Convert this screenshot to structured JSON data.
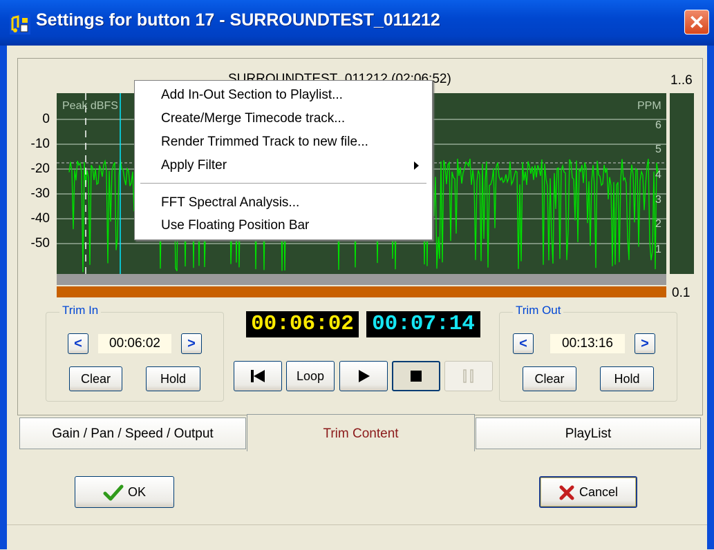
{
  "window": {
    "title": "Settings for button 17 - SURROUNDTEST_011212",
    "close_glyph": "✕"
  },
  "waveform": {
    "title": "SURROUNDTEST_011212   (02:06:52)",
    "scale_top": "1..6",
    "scale_bottom": "0.1",
    "peak_label": "Peak dBFS",
    "ppm_label": "PPM",
    "y_labels": [
      "0",
      "-10",
      "-20",
      "-30",
      "-40",
      "-50"
    ],
    "ppm_labels": [
      "6",
      "5",
      "4",
      "3",
      "2",
      "1"
    ],
    "colors": {
      "background": "#2c4a2c",
      "wave": "#00e000",
      "grid": "#c8d8c8",
      "cursor": "#00e8ff",
      "orange_bar": "#c86000"
    }
  },
  "context_menu": {
    "items": [
      {
        "label": "Add In-Out Section to Playlist..."
      },
      {
        "label": "Create/Merge Timecode track..."
      },
      {
        "label": "Render Trimmed Track to new file..."
      },
      {
        "label": "Apply Filter",
        "submenu": true
      },
      {
        "label": "FFT Spectral Analysis..."
      },
      {
        "label": "Use Floating Position Bar"
      }
    ]
  },
  "trim_in": {
    "label": "Trim In",
    "value": "00:06:02",
    "prev": "<",
    "next": ">",
    "clear": "Clear",
    "hold": "Hold"
  },
  "trim_out": {
    "label": "Trim Out",
    "value": "00:13:16",
    "prev": "<",
    "next": ">",
    "clear": "Clear",
    "hold": "Hold"
  },
  "timers": {
    "elapsed": "00:06:02",
    "remaining": "00:07:14"
  },
  "transport": {
    "skip_start_icon": "skip-to-start-icon",
    "loop": "Loop",
    "play_icon": "play-icon",
    "stop_icon": "stop-icon",
    "pause_icon": "pause-icon"
  },
  "tabs": [
    {
      "label": "Gain / Pan / Speed / Output"
    },
    {
      "label": "Trim Content",
      "active": true
    },
    {
      "label": "PlayList"
    }
  ],
  "buttons": {
    "ok": "OK",
    "cancel": "Cancel"
  }
}
